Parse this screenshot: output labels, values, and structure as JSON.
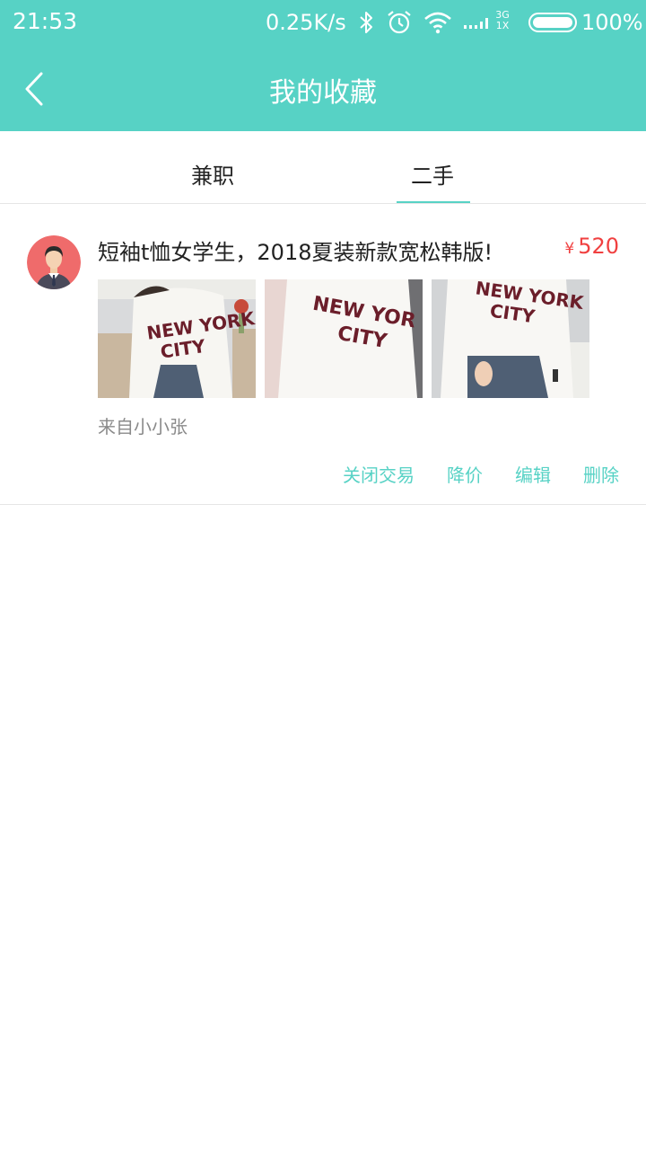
{
  "status_bar": {
    "time": "21:53",
    "net_speed": "0.25K/s",
    "network_type_top": "3G",
    "network_type_bottom": "1X",
    "battery": "100%",
    "icons": [
      "bluetooth-icon",
      "alarm-icon",
      "wifi-icon",
      "signal-icon",
      "battery-icon"
    ]
  },
  "header": {
    "title": "我的收藏",
    "back_icon": "chevron-left-icon",
    "background": "#57d2c5"
  },
  "tabs": [
    {
      "label": "兼职",
      "active": false
    },
    {
      "label": "二手",
      "active": true
    }
  ],
  "items": [
    {
      "title": "短袖t恤女学生，2018夏装新款宽松韩版!",
      "currency": "¥",
      "price": "520",
      "from": "来自小小张",
      "actions": [
        "关闭交易",
        "降价",
        "编辑",
        "删除"
      ]
    }
  ],
  "colors": {
    "accent": "#57d2c5",
    "price": "#f04040",
    "muted": "#8a8a8a"
  }
}
